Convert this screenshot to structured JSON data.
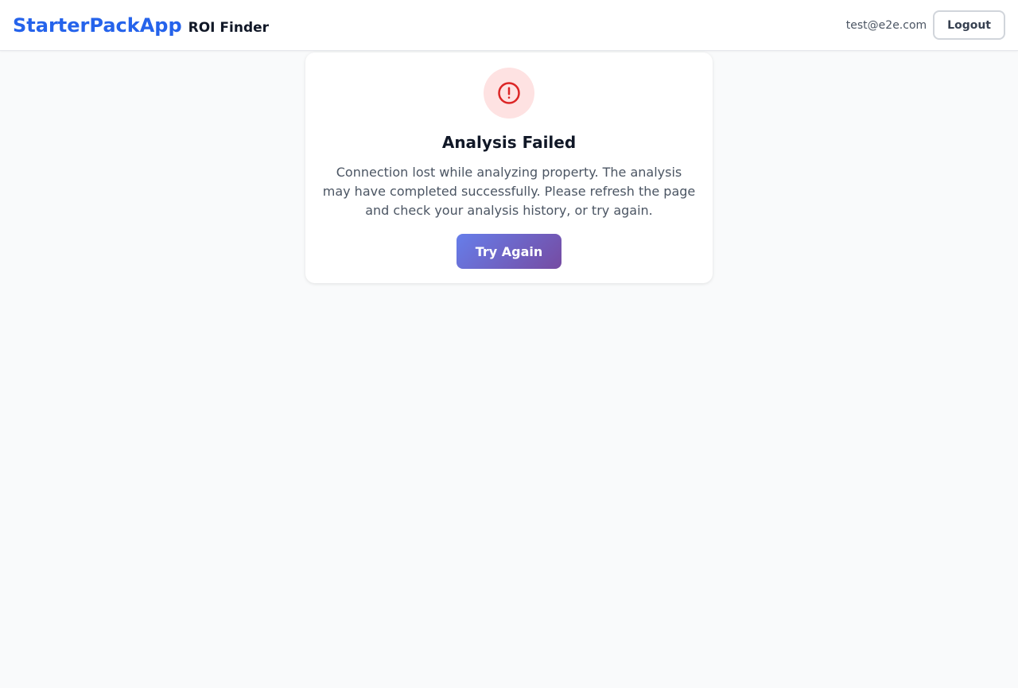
{
  "header": {
    "brand": "StarterPackApp",
    "product": "ROI Finder",
    "user_email": "test@e2e.com",
    "logout_label": "Logout"
  },
  "error": {
    "icon": "alert-circle-icon",
    "title": "Analysis Failed",
    "message": "Connection lost while analyzing property. The analysis may have completed successfully. Please refresh the page and check your analysis history, or try again.",
    "retry_label": "Try Again"
  },
  "colors": {
    "brand": "#2563eb",
    "error": "#dc2626",
    "error_bg": "#fee2e2",
    "button_gradient_start": "#667eea",
    "button_gradient_end": "#764ba2"
  }
}
